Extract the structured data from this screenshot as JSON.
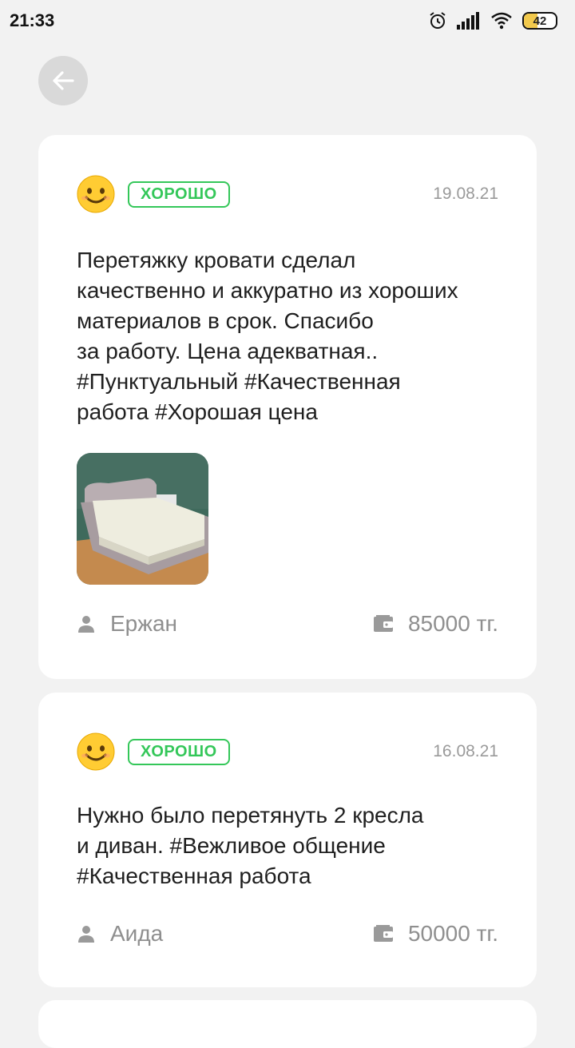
{
  "status_bar": {
    "time": "21:33",
    "battery": "42"
  },
  "reviews": [
    {
      "rating_label": "ХОРОШО",
      "date": "19.08.21",
      "text": "Перетяжку кровати сделал\nкачественно и аккуратно из хороших\nматериалов в срок. Спасибо\nза работу. Цена адекватная..\n#Пунктуальный #Качественная\nработа #Хорошая цена",
      "author": "Ержан",
      "price": "85000 тг."
    },
    {
      "rating_label": "ХОРОШО",
      "date": "16.08.21",
      "text": "Нужно было перетянуть 2 кресла\nи диван.  #Вежливое общение\n#Качественная работа",
      "author": "Аида",
      "price": "50000 тг."
    }
  ],
  "colors": {
    "accent_green": "#34c759",
    "badge_battery": "#f2c94c"
  },
  "icons": [
    "alarm-icon",
    "signal-icon",
    "wifi-icon",
    "battery-icon",
    "back-arrow-icon",
    "smiley-icon",
    "user-icon",
    "wallet-icon"
  ]
}
